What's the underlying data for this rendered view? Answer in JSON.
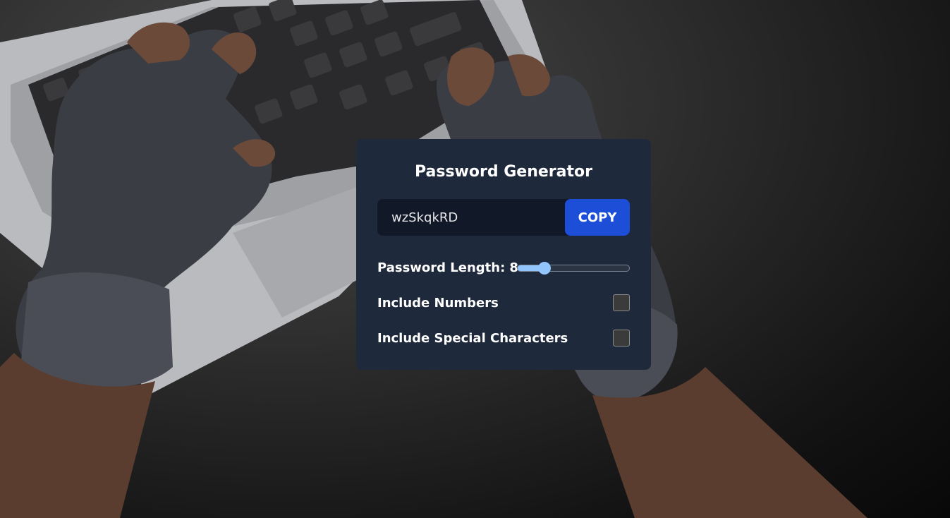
{
  "app": {
    "title": "Password Generator"
  },
  "password": {
    "value": "wzSkqkRD",
    "copy_label": "COPY"
  },
  "length": {
    "label": "Password Length:",
    "value": "8",
    "slider_fraction": 0.24
  },
  "options": {
    "numbers_label": "Include Numbers",
    "numbers_checked": false,
    "special_label": "Include Special Characters",
    "special_checked": false
  },
  "colors": {
    "card_bg": "#1e293b",
    "input_bg": "#111827",
    "accent": "#1d4ed8",
    "slider": "#93c5fd"
  },
  "background": {
    "icon": "photo-hands-typing-on-laptop"
  }
}
